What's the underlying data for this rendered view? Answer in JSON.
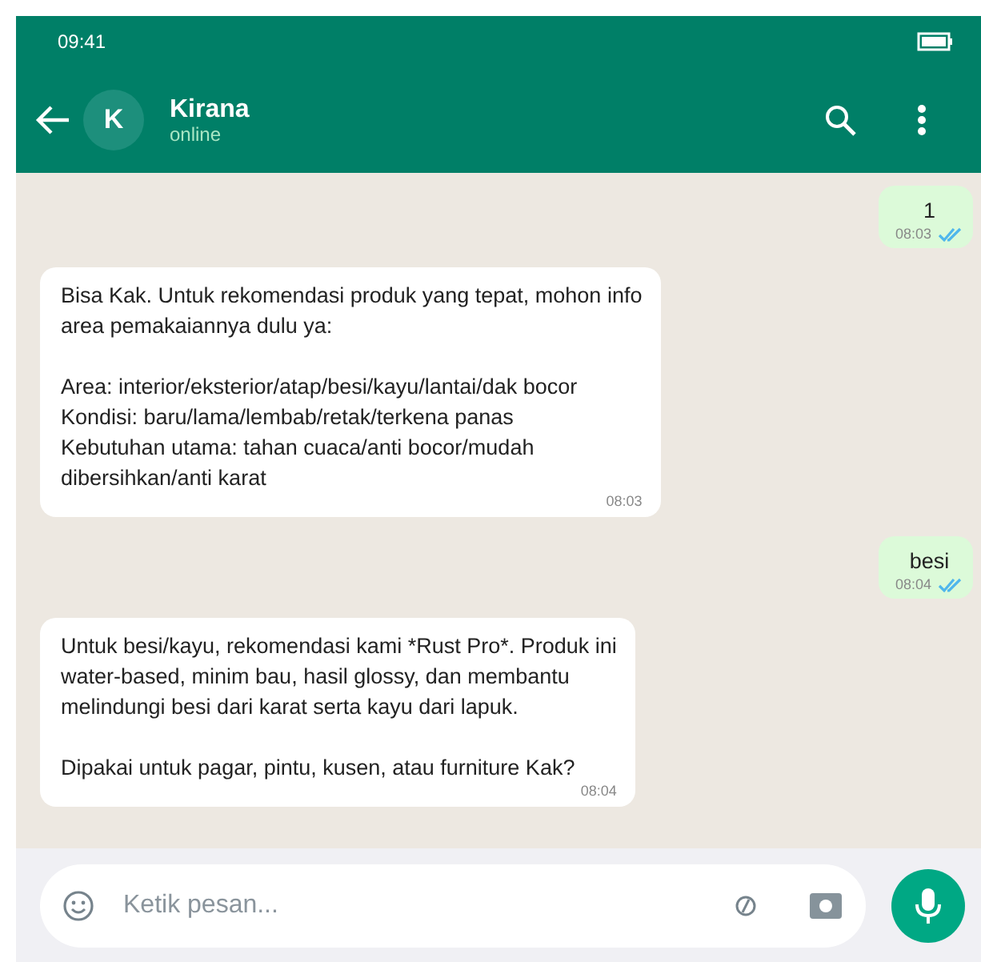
{
  "status_bar": {
    "time": "09:41"
  },
  "header": {
    "avatar_letter": "K",
    "name": "Kirana",
    "presence": "online"
  },
  "messages": [
    {
      "kind": "outgoing",
      "text": "1",
      "time": "08:03",
      "read": true
    },
    {
      "kind": "incoming",
      "text": "Bisa Kak. Untuk rekomendasi produk yang tepat, mohon info\narea pemakaiannya dulu ya:\n\nArea: interior/eksterior/atap/besi/kayu/lantai/dak bocor\nKondisi: baru/lama/lembab/retak/terkena panas\nKebutuhan utama: tahan cuaca/anti bocor/mudah\ndibersihkan/anti karat",
      "time": "08:03"
    },
    {
      "kind": "outgoing",
      "text": "besi",
      "time": "08:04",
      "read": true
    },
    {
      "kind": "incoming",
      "text": "Untuk besi/kayu, rekomendasi kami *Rust Pro*. Produk ini\nwater-based, minim bau, hasil glossy, dan membantu\nmelindungi besi dari karat serta kayu dari lapuk.\n\nDipakai untuk pagar, pintu, kusen, atau furniture Kak?",
      "time": "08:04"
    }
  ],
  "composer": {
    "placeholder": "Ketik pesan..."
  }
}
